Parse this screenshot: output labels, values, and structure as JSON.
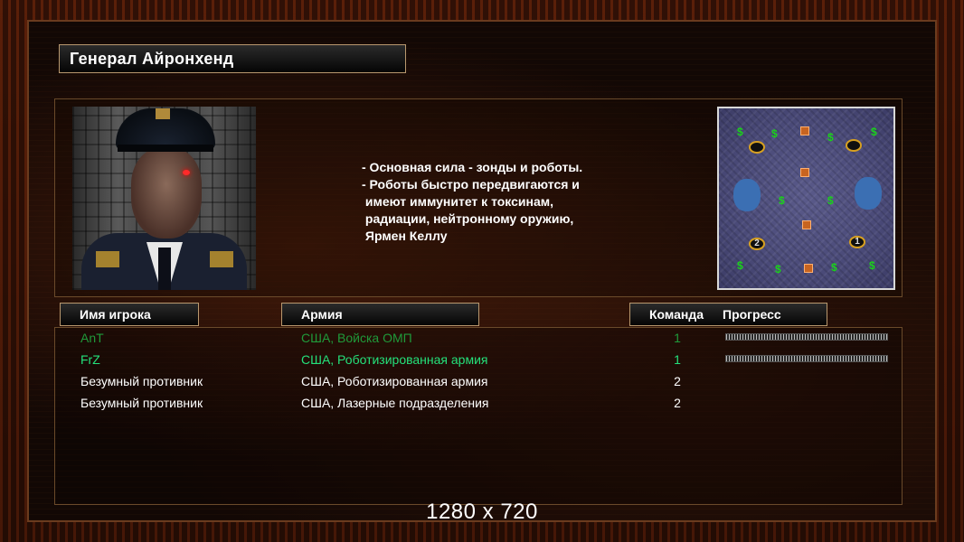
{
  "title": "Генерал Айронхенд",
  "description": [
    "- Основная сила - зонды и роботы.",
    "- Роботы быстро передвигаются и",
    " имеют иммунитет к токсинам,",
    " радиации, нейтронному оружию,",
    " Ярмен Келлу"
  ],
  "columns": {
    "player": "Имя игрока",
    "army": "Армия",
    "team": "Команда",
    "progress": "Прогресс"
  },
  "players": [
    {
      "name": "AnT",
      "army": "США, Войска ОМП",
      "team": "1",
      "color": "#1f9a3a",
      "progress": 1.0
    },
    {
      "name": "FrZ",
      "army": "США, Роботизированная армия",
      "team": "1",
      "color": "#24e07a",
      "progress": 1.0
    },
    {
      "name": "Безумный противник",
      "army": "США, Роботизированная армия",
      "team": "2",
      "color": "#ffffff"
    },
    {
      "name": "Безумный противник",
      "army": "США, Лазерные подразделения",
      "team": "2",
      "color": "#ffffff"
    }
  ],
  "minimap": {
    "start_positions": [
      "1",
      "2"
    ]
  },
  "resolution": "1280 x 720"
}
